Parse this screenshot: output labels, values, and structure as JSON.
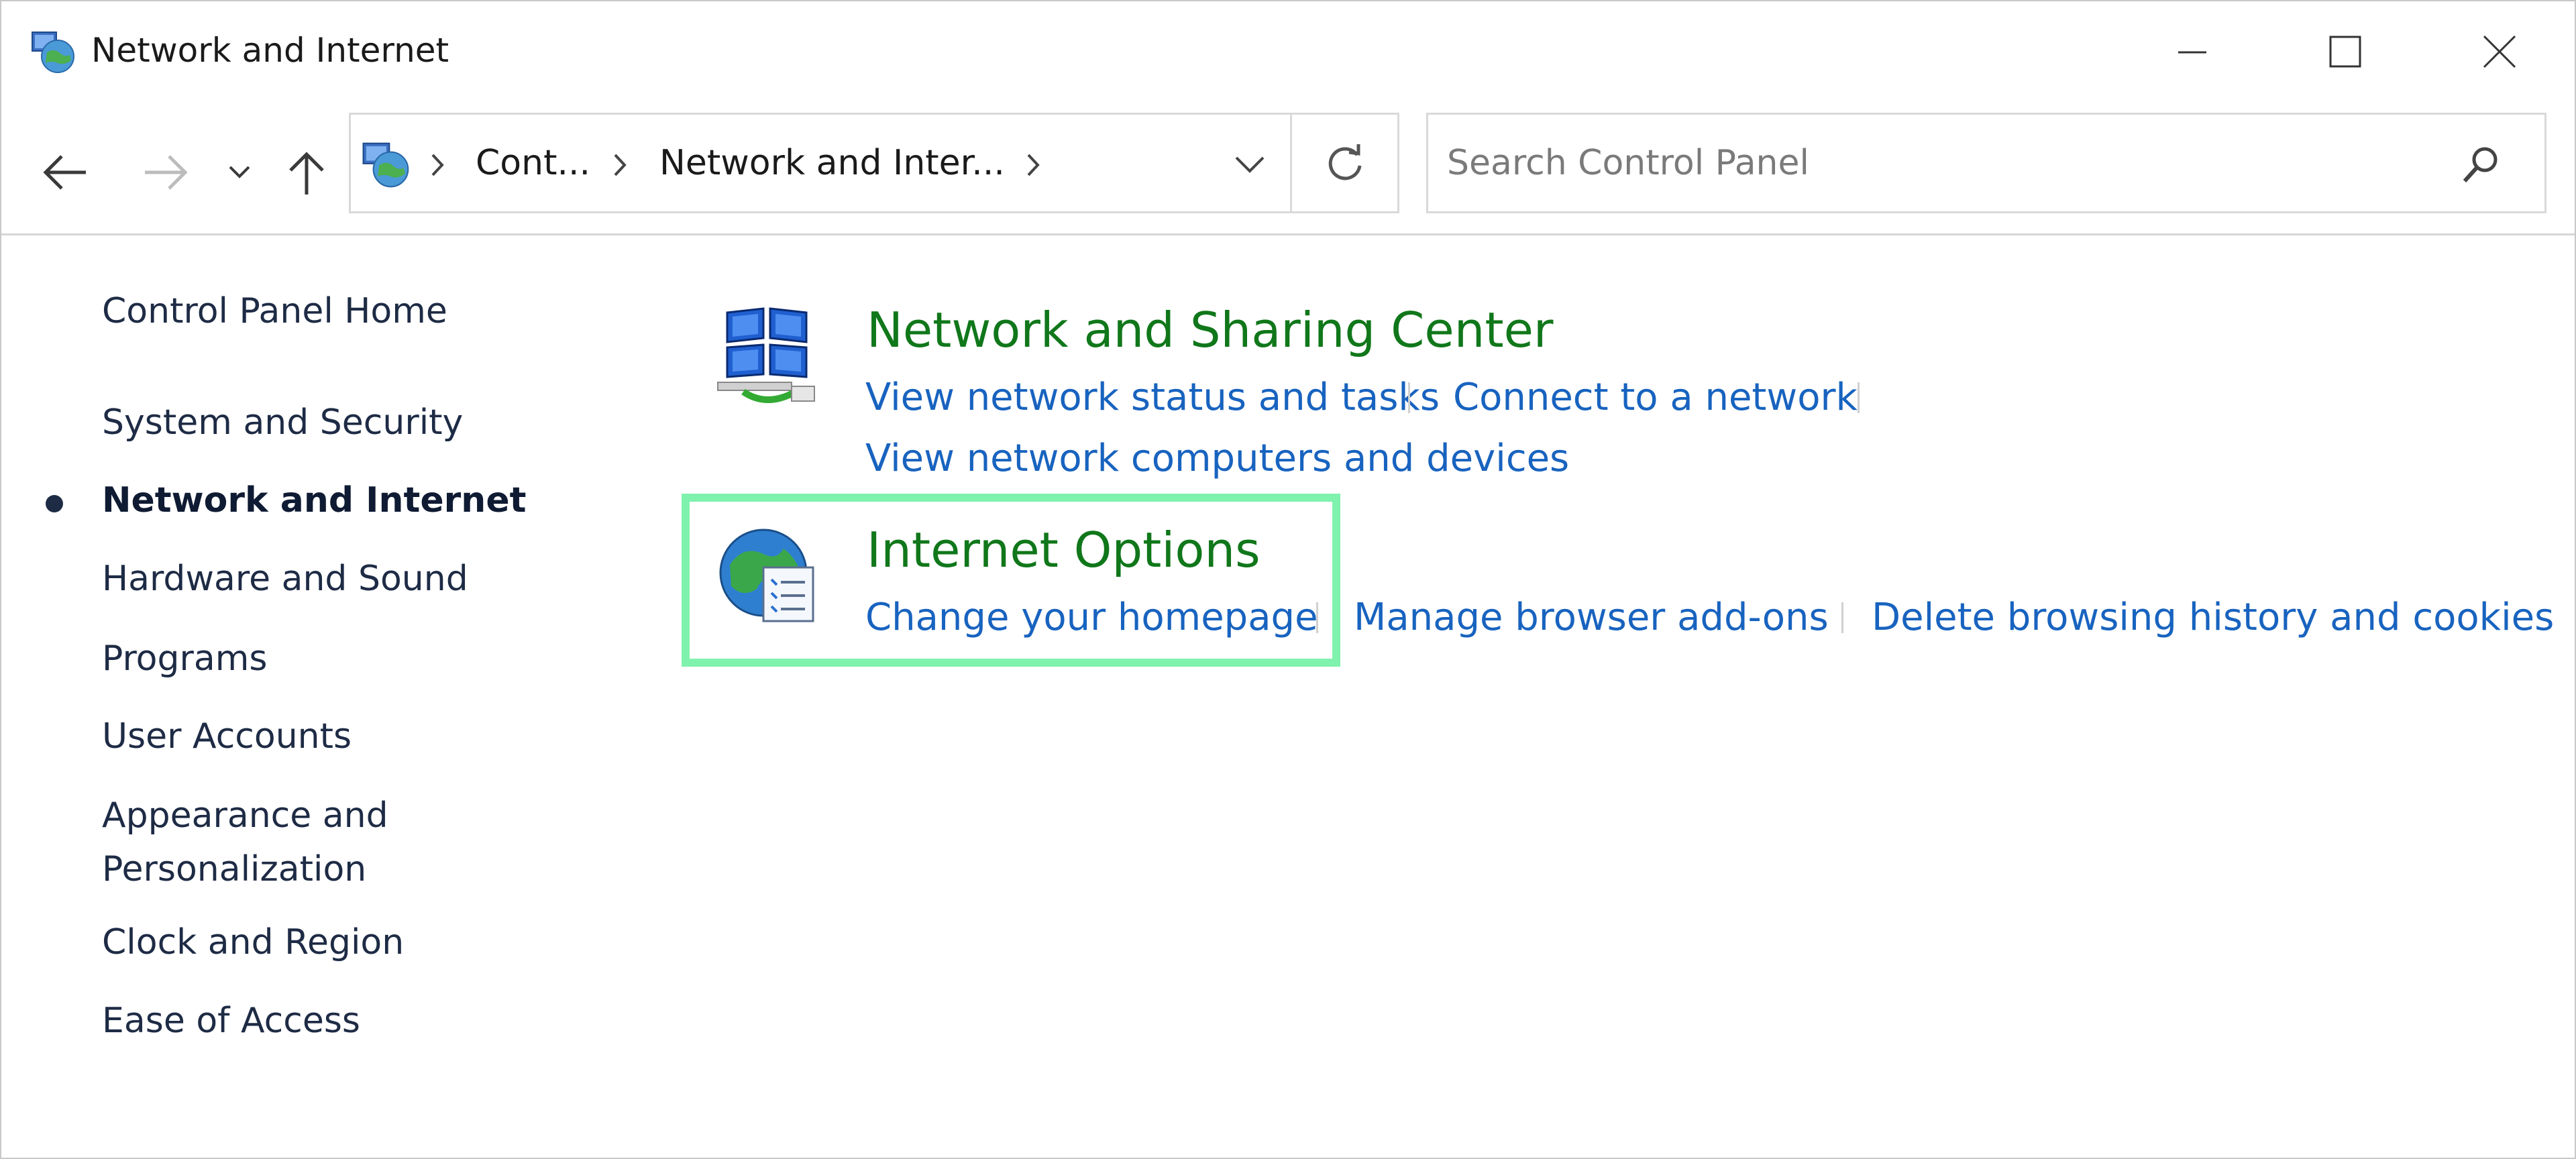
{
  "window": {
    "title": "Network and Internet"
  },
  "navigation": {
    "breadcrumbs": [
      "Cont...",
      "Network and Inter..."
    ],
    "search_placeholder": "Search Control Panel"
  },
  "sidebar": {
    "items": [
      {
        "label": "Control Panel Home"
      },
      {
        "label": "System and Security"
      },
      {
        "label": "Network and Internet",
        "active": true
      },
      {
        "label": "Hardware and Sound"
      },
      {
        "label": "Programs"
      },
      {
        "label": "User Accounts"
      },
      {
        "label": "Appearance and"
      },
      {
        "label": "Personalization"
      },
      {
        "label": "Clock and Region"
      },
      {
        "label": "Ease of Access"
      }
    ]
  },
  "categories": [
    {
      "title": "Network and Sharing Center",
      "icon": "network-monitors-icon",
      "links": [
        "View network status and tasks",
        "Connect to a network",
        "View network computers and devices"
      ]
    },
    {
      "title": "Internet Options",
      "icon": "globe-document-icon",
      "links": [
        "Change your homepage",
        "Manage browser add-ons",
        "Delete browsing history and cookies"
      ]
    }
  ],
  "colors": {
    "category_title": "#10771a",
    "link": "#1863bf",
    "highlight_border": "#7ff2ad",
    "sidebar_text": "#1e2b45"
  }
}
